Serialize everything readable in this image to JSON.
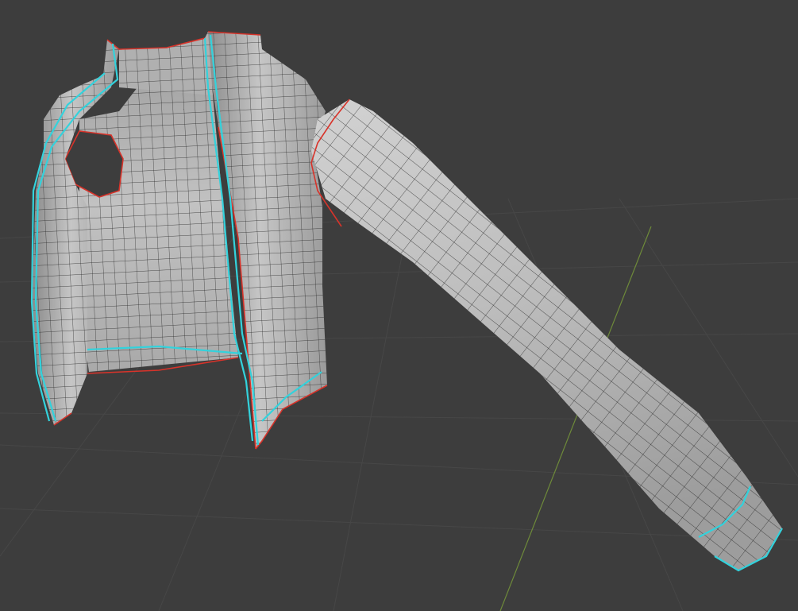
{
  "viewport": {
    "background_color": "#3d3d3d",
    "grid_color": "#474747",
    "y_axis_color": "#6e8a3a",
    "mesh_base_color": "#b5b5b5",
    "wire_color": "#1f1f1f",
    "seam_colors": {
      "boundary": "#d8332a",
      "selection": "#33d2dc"
    }
  },
  "scene": {
    "object": "jacket-mesh",
    "parts": [
      "torso-left-panel",
      "torso-right-panel",
      "back-panel",
      "collar",
      "left-sleeve",
      "armhole"
    ]
  }
}
